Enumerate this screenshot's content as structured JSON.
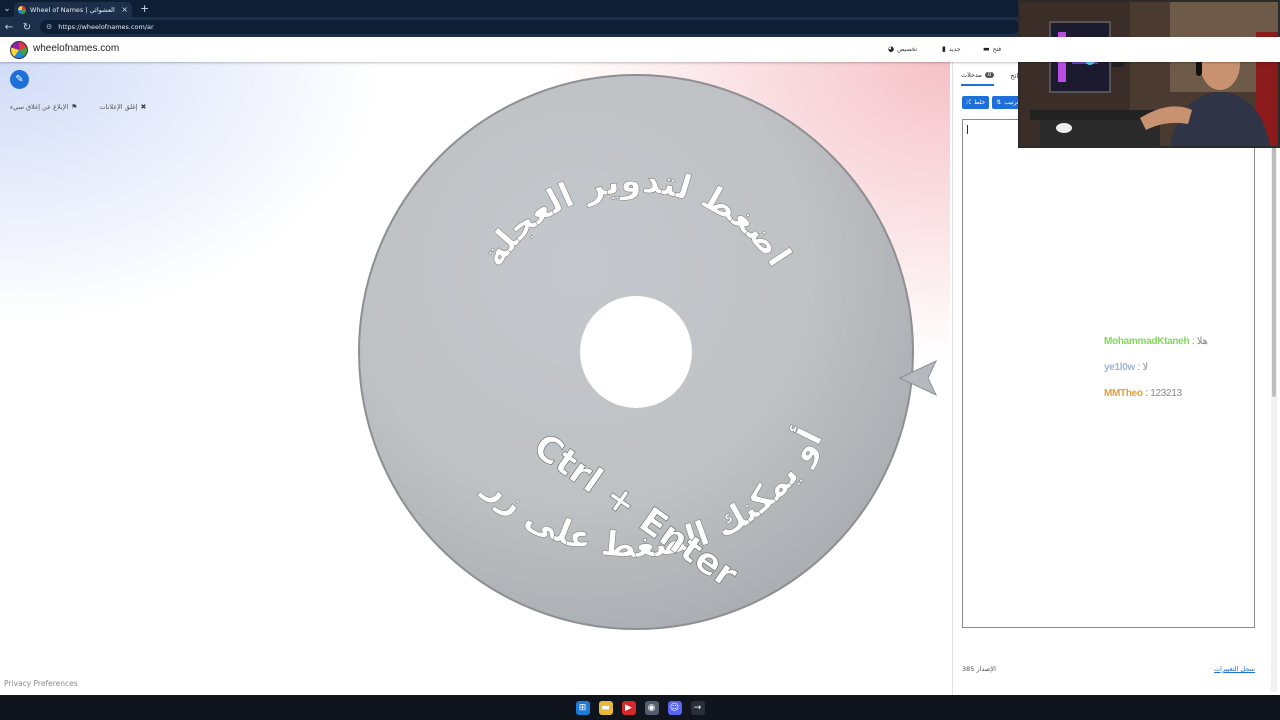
{
  "browser": {
    "tab_title": "Wheel of Names | الاسم العشوائي",
    "close_glyph": "×",
    "new_tab_glyph": "+",
    "dropdown_glyph": "⌄",
    "url": "https://wheelofnames.com/ar"
  },
  "app": {
    "brand": "wheelofnames.com",
    "menu": {
      "customize": "تخصيص",
      "new": "جديد",
      "open": "فتح"
    }
  },
  "main": {
    "ad_close_label": "إغلق الإعلانات",
    "ad_report_label": "الإبلاغ عن إغلاق سيء",
    "privacy": "Privacy Preferences"
  },
  "wheel": {
    "top_text": "اضغط لتدوير العجلة",
    "bottom_text": "أو يمكنك الضغط على زر",
    "shortcut_text": "Ctrl + Enter",
    "face_color": "#c9c9c9",
    "hub_color": "#ffffff"
  },
  "sidebar": {
    "tab_entries": "مدخلات",
    "tab_results": "نتائج",
    "entries_count": "0",
    "results_count": "0",
    "shuffle_label": "خلط",
    "sort_label": "ترتيب",
    "version_label": "الإصدار 385",
    "changelog_label": "سجل التغييرات"
  },
  "chat": [
    {
      "user": "MohammadKtaneh",
      "separator": ":",
      "message": "هلا",
      "color": "#7fd957"
    },
    {
      "user": "ye1l0w",
      "separator": ":",
      "message": "لا",
      "color": "#9fb3d9"
    },
    {
      "user": "MMTheo",
      "separator": ":",
      "message": "123213",
      "color": "#e0a23a"
    }
  ],
  "colors": {
    "accent": "#1e6fd9",
    "browser_dark": "#0e1e35"
  }
}
